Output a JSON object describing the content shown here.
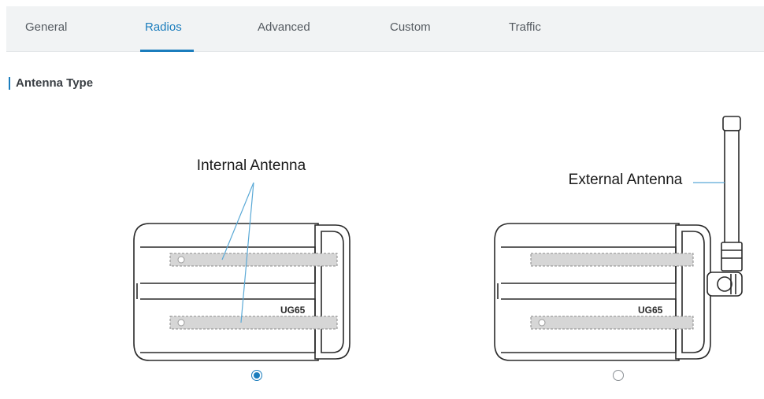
{
  "tabs": {
    "general": "General",
    "radios": "Radios",
    "advanced": "Advanced",
    "custom": "Custom",
    "traffic": "Traffic",
    "active": "Radios"
  },
  "section": {
    "title": "Antenna Type"
  },
  "options": {
    "internal": {
      "label": "Internal Antenna",
      "device_label": "UG65",
      "selected": true
    },
    "external": {
      "label": "External Antenna",
      "device_label": "UG65",
      "selected": false
    }
  },
  "colors": {
    "accent": "#1b7dbd",
    "tabbar_bg": "#f1f3f4",
    "text": "#3a3f44"
  }
}
